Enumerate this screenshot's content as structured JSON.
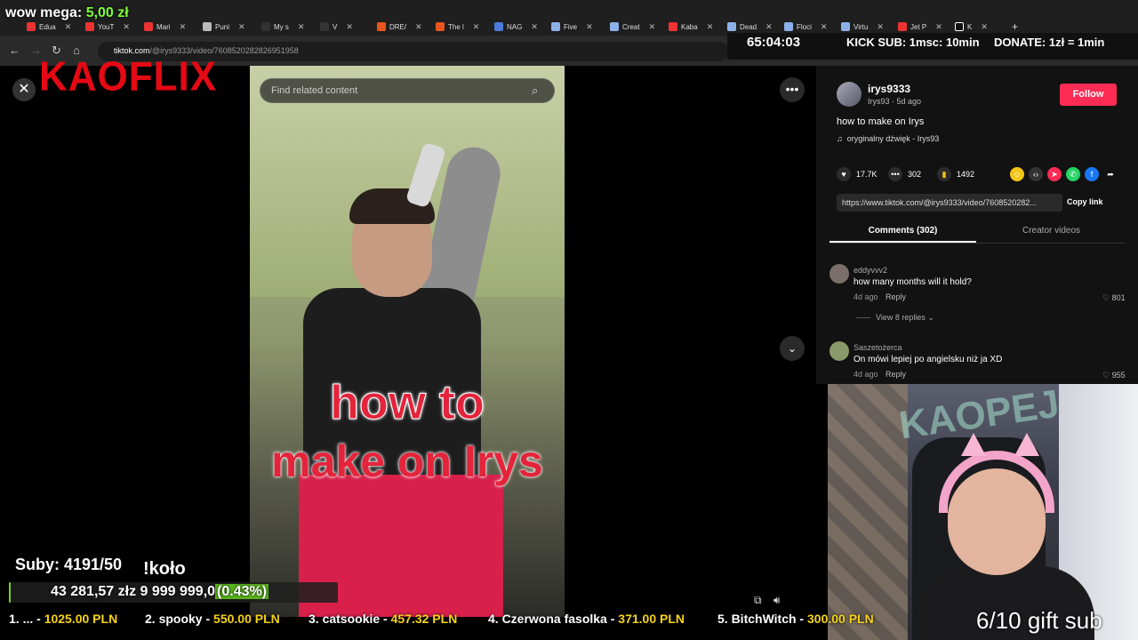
{
  "overlay": {
    "wow_label": "wow mega: ",
    "wow_amount": "5,00 zł",
    "countdown": "65:04:03",
    "kick_sub": "KICK SUB: 1msc: 10min",
    "donate": "DONATE: 1zł = 1min",
    "logo": "KAOFLIX",
    "subs": "Suby: 4191/50",
    "kolo": "!koło",
    "goal_text": "43 281,57 złz  9 999 999,0",
    "goal_pct_label": "(0.43%)",
    "goal_progress": 0.0043,
    "gift_sub": "6/10 gift sub",
    "ticker": [
      {
        "label": "1. ... - ",
        "amount": "1025.00 PLN"
      },
      {
        "label": "2. spooky - ",
        "amount": "550.00 PLN"
      },
      {
        "label": "3. catsookie - ",
        "amount": "457.32 PLN"
      },
      {
        "label": "4. Czerwona fasolka - ",
        "amount": "371.00 PLN"
      },
      {
        "label": "5. BitchWitch - ",
        "amount": "300.00 PLN"
      }
    ]
  },
  "browser": {
    "tabs": [
      "Edua",
      "YouT",
      "Mari",
      "Puni",
      "My s",
      "V",
      "DRE/",
      "The l",
      "NAG",
      "Five",
      "Creat",
      "Kaba",
      "Dead",
      "Floci",
      "Virtu",
      "Jet P",
      "K"
    ],
    "url_host": "tiktok.com",
    "url_path": "/@irys9333/video/7608520282826951958"
  },
  "tiktok": {
    "search_placeholder": "Find related content",
    "caption_line1": "how to",
    "caption_line2": "make on Irys",
    "username": "irys9333",
    "user_meta": "Irys93 · 5d ago",
    "follow_label": "Follow",
    "description": "how to make on Irys",
    "sound": "oryginalny dźwięk - Irys93",
    "likes": "17.7K",
    "comments_count": "302",
    "saves": "1492",
    "link": "https://www.tiktok.com/@irys9333/video/7608520282...",
    "copy_link": "Copy link",
    "tab_comments": "Comments (302)",
    "tab_creator": "Creator videos",
    "comments": [
      {
        "user": "eddyvvv2",
        "text": "how many months will it hold?",
        "age": "4d ago",
        "reply": "Reply",
        "likes": "801",
        "replies": "View 8 replies"
      },
      {
        "user": "Saszetożerca",
        "text": "On mówi lepiej po angielsku niż ja XD",
        "age": "4d ago",
        "reply": "Reply",
        "likes": "955"
      }
    ]
  },
  "colors": {
    "accent": "#fe2c55",
    "logo": "#e50914",
    "money": "#f5d21a",
    "progress": "#7fd321"
  }
}
